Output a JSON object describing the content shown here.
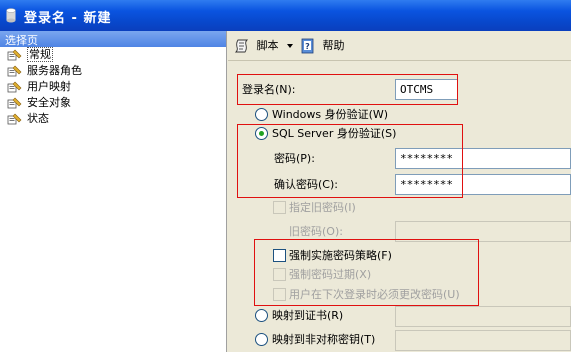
{
  "window": {
    "title": "登录名 - 新建"
  },
  "left_pane": {
    "header": "选择页",
    "items": [
      {
        "label": "常规",
        "selected": true
      },
      {
        "label": "服务器角色"
      },
      {
        "label": "用户映射"
      },
      {
        "label": "安全对象"
      },
      {
        "label": "状态"
      }
    ]
  },
  "toolbar": {
    "script_label": "脚本",
    "help_label": "帮助"
  },
  "form": {
    "login_name_label": "登录名(N):",
    "login_name_value": "OTCMS",
    "windows_auth_label": "Windows 身份验证(W)",
    "sql_auth_label": "SQL Server 身份验证(S)",
    "password_label": "密码(P):",
    "password_value": "********",
    "confirm_password_label": "确认密码(C):",
    "confirm_password_value": "********",
    "specify_old_password_label": "指定旧密码(I)",
    "old_password_label": "旧密码(O):",
    "enforce_policy_label": "强制实施密码策略(F)",
    "enforce_expiration_label": "强制密码过期(X)",
    "must_change_label": "用户在下次登录时必须更改密码(U)",
    "map_certificate_label": "映射到证书(R)",
    "map_asym_key_label": "映射到非对称密钥(T)"
  },
  "colors": {
    "title_bar": "#0a54e0",
    "highlight_box": "#e01010",
    "radio_dot": "#21a121"
  }
}
